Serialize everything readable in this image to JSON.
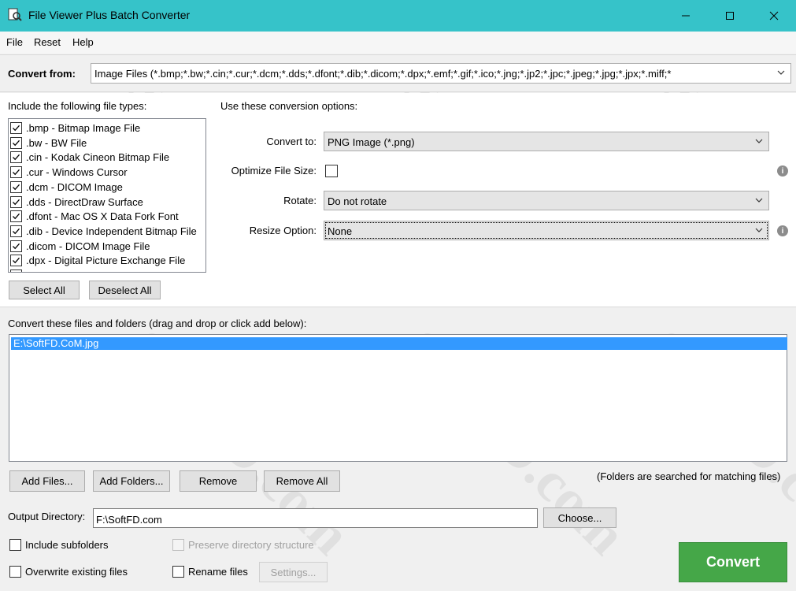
{
  "window": {
    "title": "File Viewer Plus Batch Converter"
  },
  "menu": {
    "items": [
      "File",
      "Reset",
      "Help"
    ]
  },
  "convert_from": {
    "label": "Convert from:",
    "value": "Image Files (*.bmp;*.bw;*.cin;*.cur;*.dcm;*.dds;*.dfont;*.dib;*.dicom;*.dpx;*.emf;*.gif;*.ico;*.jng;*.jp2;*.jpc;*.jpeg;*.jpg;*.jpx;*.miff;*"
  },
  "file_types": {
    "heading": "Include the following file types:",
    "items": [
      {
        "label": ".bmp - Bitmap Image File",
        "checked": true
      },
      {
        "label": ".bw - BW File",
        "checked": true
      },
      {
        "label": ".cin - Kodak Cineon Bitmap File",
        "checked": true
      },
      {
        "label": ".cur - Windows Cursor",
        "checked": true
      },
      {
        "label": ".dcm - DICOM Image",
        "checked": true
      },
      {
        "label": ".dds - DirectDraw Surface",
        "checked": true
      },
      {
        "label": ".dfont - Mac OS X Data Fork Font",
        "checked": true
      },
      {
        "label": ".dib - Device Independent Bitmap File",
        "checked": true
      },
      {
        "label": ".dicom - DICOM Image File",
        "checked": true
      },
      {
        "label": ".dpx - Digital Picture Exchange File",
        "checked": true
      }
    ],
    "select_all": "Select All",
    "deselect_all": "Deselect All"
  },
  "options": {
    "heading": "Use these conversion options:",
    "convert_to_label": "Convert to:",
    "convert_to_value": "PNG Image (*.png)",
    "optimize_label": "Optimize File Size:",
    "optimize_checked": false,
    "rotate_label": "Rotate:",
    "rotate_value": "Do not rotate",
    "resize_label": "Resize Option:",
    "resize_value": "None"
  },
  "files": {
    "heading": "Convert these files and folders (drag and drop or click add below):",
    "items": [
      "E:\\SoftFD.CoM.jpg"
    ],
    "add_files": "Add Files...",
    "add_folders": "Add Folders...",
    "remove": "Remove",
    "remove_all": "Remove All",
    "note": "(Folders are searched for matching files)"
  },
  "output": {
    "label": "Output Directory:",
    "value": "F:\\SoftFD.com",
    "choose": "Choose..."
  },
  "checks": {
    "include_subfolders": "Include subfolders",
    "preserve_structure": "Preserve directory structure",
    "overwrite": "Overwrite existing files",
    "rename": "Rename files",
    "settings": "Settings..."
  },
  "convert_button": "Convert",
  "watermark": "SoftFD.com",
  "colors": {
    "titlebar": "#36c3c9",
    "selection": "#3399ff",
    "convert": "#45a748"
  }
}
